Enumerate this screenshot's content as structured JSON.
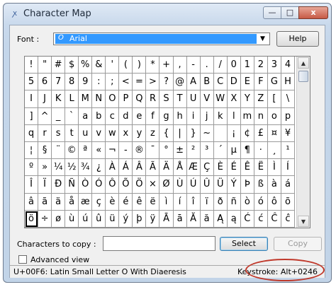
{
  "window": {
    "title": "Character Map",
    "icon": "character-map-icon",
    "controls": {
      "minimize": "—",
      "maximize": "□",
      "close": "x"
    }
  },
  "font": {
    "label": "Font :",
    "value": "Arial",
    "glyph": "O",
    "arrow": "▼"
  },
  "help_button": "Help",
  "grid": {
    "rows": [
      [
        "!",
        "\"",
        "#",
        "$",
        "%",
        "&",
        "'",
        "(",
        ")",
        "*",
        "+",
        ",",
        "-",
        ".",
        "/",
        "0",
        "1",
        "2",
        "3",
        "4"
      ],
      [
        "5",
        "6",
        "7",
        "8",
        "9",
        ":",
        ";",
        "<",
        "=",
        ">",
        "?",
        "@",
        "A",
        "B",
        "C",
        "D",
        "E",
        "F",
        "G",
        "H"
      ],
      [
        "I",
        "J",
        "K",
        "L",
        "M",
        "N",
        "O",
        "P",
        "Q",
        "R",
        "S",
        "T",
        "U",
        "V",
        "W",
        "X",
        "Y",
        "Z",
        "[",
        "\\"
      ],
      [
        "]",
        "^",
        "_",
        "`",
        "a",
        "b",
        "c",
        "d",
        "e",
        "f",
        "g",
        "h",
        "i",
        "j",
        "k",
        "l",
        "m",
        "n",
        "o",
        "p"
      ],
      [
        "q",
        "r",
        "s",
        "t",
        "u",
        "v",
        "w",
        "x",
        "y",
        "z",
        "{",
        "|",
        "}",
        "~",
        " ",
        "¡",
        "¢",
        "£",
        "¤",
        "¥"
      ],
      [
        "¦",
        "§",
        "¨",
        "©",
        "ª",
        "«",
        "¬",
        "-",
        "®",
        "¯",
        "°",
        "±",
        "²",
        "³",
        "´",
        "µ",
        "¶",
        "·",
        "¸",
        "¹"
      ],
      [
        "º",
        "»",
        "¼",
        "½",
        "¾",
        "¿",
        "À",
        "Á",
        "Â",
        "Ã",
        "Ä",
        "Å",
        "Æ",
        "Ç",
        "È",
        "É",
        "Ê",
        "Ë",
        "Ì",
        "Í"
      ],
      [
        "Î",
        "Ï",
        "Ð",
        "Ñ",
        "Ò",
        "Ó",
        "Ô",
        "Õ",
        "Ö",
        "×",
        "Ø",
        "Ù",
        "Ú",
        "Û",
        "Ü",
        "Ý",
        "Þ",
        "ß",
        "à",
        "á"
      ],
      [
        "â",
        "ã",
        "ä",
        "å",
        "æ",
        "ç",
        "è",
        "é",
        "ê",
        "ë",
        "ì",
        "í",
        "î",
        "ï",
        "ð",
        "ñ",
        "ò",
        "ó",
        "ô",
        "õ"
      ],
      [
        "ö",
        "÷",
        "ø",
        "ù",
        "ú",
        "û",
        "ü",
        "ý",
        "þ",
        "ÿ",
        "Ā",
        "ā",
        "Ă",
        "ă",
        "Ą",
        "ą",
        "Ć",
        "ć",
        "Ĉ",
        "ĉ"
      ]
    ],
    "selected": {
      "row": 9,
      "col": 0
    }
  },
  "scrollbar": {
    "up": "▲",
    "down": "▼"
  },
  "copy": {
    "label": "Characters to copy :",
    "value": "",
    "select_button": "Select",
    "copy_button": "Copy"
  },
  "advanced_view": {
    "label": "Advanced view",
    "checked": false
  },
  "status": {
    "description": "U+00F6: Latin Small Letter O With Diaeresis",
    "keystroke": "Keystroke: Alt+0246"
  },
  "colors": {
    "highlight_ring": "#c0392b",
    "font_selection": "#3399ff"
  }
}
